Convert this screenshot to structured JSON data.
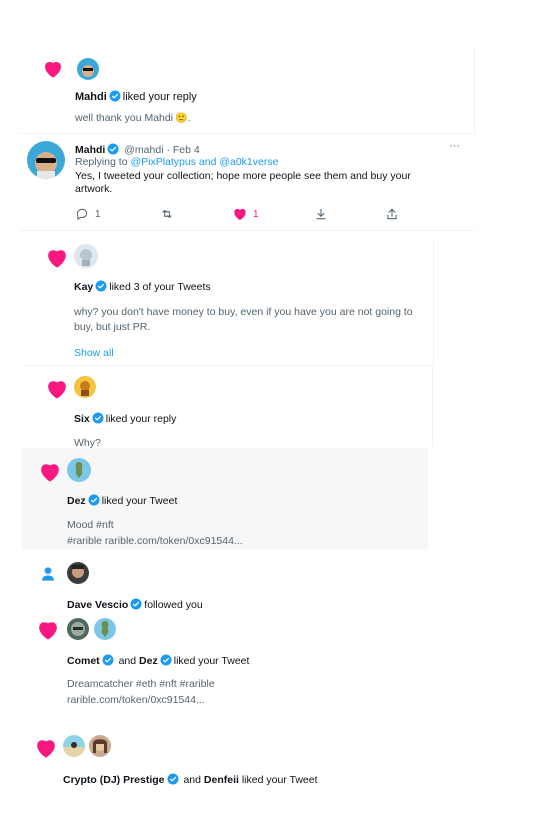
{
  "n1": {
    "name": "Mahdi",
    "action": "liked your reply",
    "text": "well thank you Mahdi",
    "emoji": "🙂"
  },
  "reply": {
    "name": "Mahdi",
    "handle": "@mahdi",
    "dot": "·",
    "date": "Feb 4",
    "more": "···",
    "replying_prefix": "Replying to",
    "replying_to": "@PixPlatypus and @a0k1verse",
    "line1": "Yes, I tweeted your collection; hope more people see them and buy your",
    "line2": "artwork.",
    "reply_count": "1",
    "retweet_count": "",
    "like_count": "1"
  },
  "n2": {
    "name": "Kay",
    "action": "liked 3 of your Tweets",
    "line1": "why? you don't have money to buy, even if you have you are not going to",
    "line2": "buy, but just PR.",
    "show_all": "Show all"
  },
  "n3": {
    "name": "Six",
    "action": "liked your reply",
    "text": "Why?"
  },
  "n4": {
    "name": "Dez",
    "action": "liked your Tweet",
    "line1": "Mood #nft",
    "line2": "#rarible rarible.com/token/0xc91544..."
  },
  "n5": {
    "name": "Dave Vescio",
    "action": "followed you"
  },
  "n6": {
    "name1": "Comet",
    "and": "and",
    "name2": "Dez",
    "action": "liked your Tweet",
    "line1": "Dreamcatcher #eth #nft #rarible",
    "line2": "rarible.com/token/0xc91544..."
  },
  "n7": {
    "name1": "Crypto (DJ) Prestige",
    "and": "and",
    "name2": "Denfeii",
    "action": "liked your Tweet"
  },
  "colors": {
    "heart": "#f91880",
    "verified": "#1d9bf0",
    "link": "#1d9bf0",
    "follow": "#1d9bf0",
    "hover_bg": "#f7f7f7"
  },
  "icons": [
    "heart-icon",
    "verified-badge-icon",
    "reply-icon",
    "retweet-icon",
    "like-icon",
    "share-icon",
    "person-icon",
    "more-icon"
  ]
}
